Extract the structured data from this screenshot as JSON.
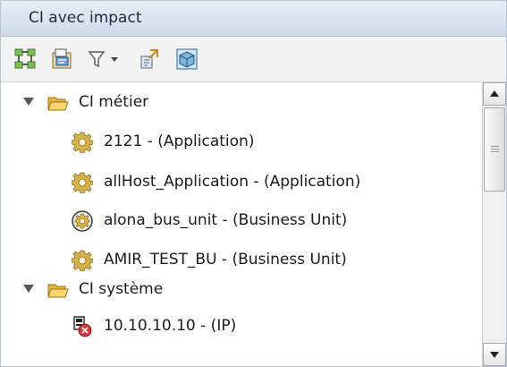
{
  "panel": {
    "title": "CI avec impact"
  },
  "toolbar": {
    "buttons": [
      {
        "icon": "tree-structure-icon"
      },
      {
        "icon": "properties-icon"
      },
      {
        "icon": "filter-icon",
        "has_dropdown": true
      },
      {
        "icon": "export-icon"
      },
      {
        "icon": "cube-icon"
      }
    ]
  },
  "tree": {
    "groups": [
      {
        "label": "CI métier",
        "expanded": true,
        "items": [
          {
            "label": "2121 - (Application)",
            "icon": "gear-icon"
          },
          {
            "label": "allHost_Application - (Application)",
            "icon": "gear-icon"
          },
          {
            "label": "alona_bus_unit - (Business Unit)",
            "icon": "business-unit-gear-icon"
          },
          {
            "label": "AMIR_TEST_BU - (Business Unit)",
            "icon": "gear-icon"
          }
        ]
      },
      {
        "label": "CI système",
        "expanded": true,
        "items": [
          {
            "label": "10.10.10.10 - (IP)",
            "icon": "ip-error-icon"
          }
        ]
      }
    ]
  },
  "colors": {
    "title_bar": "#d6e0ee",
    "folder": "#f2c64b",
    "gear": "#c9a53a"
  }
}
